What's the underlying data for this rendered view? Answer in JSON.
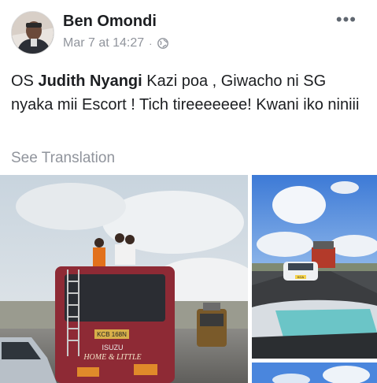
{
  "post": {
    "author": "Ben Omondi",
    "timestamp": "Mar 7 at 14:27",
    "separator": "·",
    "privacy_icon": "globe-icon",
    "more_label": "•••",
    "text_prefix": "OS ",
    "mention": "Judith Nyangi",
    "text_suffix": " Kazi poa , Giwacho ni SG nyaka mii Escort ! Tich tireeeeeee! Kwani iko niniii",
    "see_translation": "See Translation"
  },
  "photos": {
    "main_bus_sign": "KCB 168N",
    "main_bus_brand": "ISUZU",
    "main_bus_script": "HOME & LITTLE",
    "right_car_plate": "KCA"
  },
  "colors": {
    "link_gray": "#90949c",
    "text": "#1c1e21",
    "bus_red": "#8e2a35"
  }
}
